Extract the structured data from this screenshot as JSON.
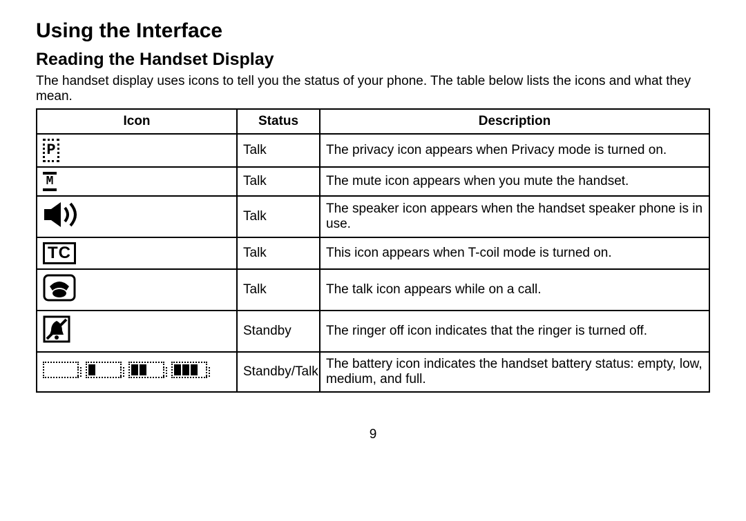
{
  "title": "Using the Interface",
  "subtitle": "Reading the Handset Display",
  "intro": "The handset display uses icons to tell you the status of your phone. The table below lists the icons and what they mean.",
  "headers": {
    "icon": "Icon",
    "status": "Status",
    "description": "Description"
  },
  "rows": [
    {
      "icon_name": "privacy-icon",
      "icon_label": "P",
      "status": "Talk",
      "description": "The privacy icon appears when Privacy mode is turned on."
    },
    {
      "icon_name": "mute-icon",
      "icon_label": "M",
      "status": "Talk",
      "description": "The mute icon appears when you mute the handset."
    },
    {
      "icon_name": "speaker-icon",
      "icon_label": "",
      "status": "Talk",
      "description": "The speaker icon appears when the handset speaker phone is in use."
    },
    {
      "icon_name": "tcoil-icon",
      "icon_label": "TC",
      "status": "Talk",
      "description": "This icon appears when T-coil mode is turned on."
    },
    {
      "icon_name": "talk-icon",
      "icon_label": "",
      "status": "Talk",
      "description": "The talk icon appears while on a call."
    },
    {
      "icon_name": "ringer-off-icon",
      "icon_label": "",
      "status": "Standby",
      "description": "The ringer off icon indicates that the ringer is turned off."
    },
    {
      "icon_name": "battery-icon",
      "icon_label": "",
      "status": "Standby/Talk",
      "description": "The battery icon indicates the handset battery status: empty, low, medium, and full."
    }
  ],
  "page_number": "9",
  "battery_levels": [
    0,
    1,
    2,
    3
  ]
}
